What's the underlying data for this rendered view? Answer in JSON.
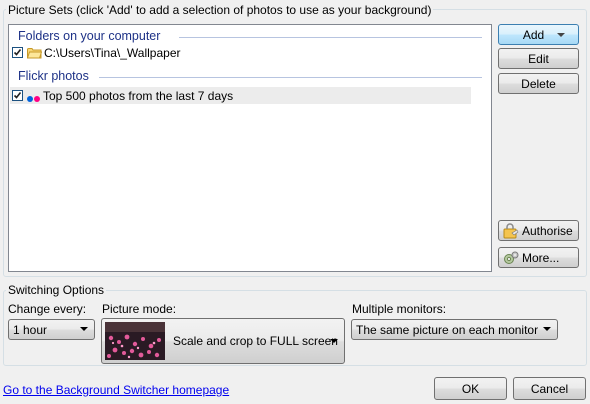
{
  "picture_sets": {
    "title": "Picture Sets (click 'Add' to add a selection of photos to use as your background)",
    "sections": [
      {
        "heading": "Folders on your computer",
        "item": {
          "label": "C:\\Users\\Tina\\_Wallpaper",
          "checked": true
        }
      },
      {
        "heading": "Flickr photos",
        "item": {
          "label": "Top 500 photos from the last 7 days",
          "checked": true
        }
      }
    ],
    "buttons": {
      "add": "Add",
      "edit": "Edit",
      "delete": "Delete",
      "authorise": "Authorise",
      "more": "More..."
    }
  },
  "switching": {
    "title": "Switching Options",
    "change_every_label": "Change every:",
    "change_every_value": "1 hour",
    "picture_mode_label": "Picture mode:",
    "picture_mode_value": "Scale and crop to FULL screen",
    "monitors_label": "Multiple monitors:",
    "monitors_value": "The same picture on each monitor"
  },
  "footer": {
    "homepage_link": "Go to the Background Switcher homepage",
    "ok": "OK",
    "cancel": "Cancel"
  },
  "colors": {
    "section_heading": "#1e3287",
    "link": "#0000ee",
    "flickr_blue": "#0063dc",
    "flickr_pink": "#ff0084"
  }
}
